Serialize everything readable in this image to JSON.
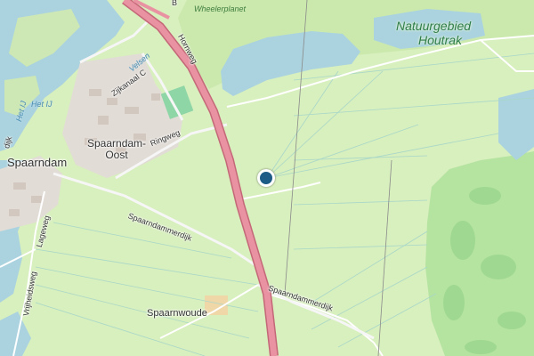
{
  "map": {
    "labels": {
      "natuurgebied": "Natuurgebied",
      "houtrak": "Houtrak",
      "wheelerplanet": "Wheelerplanet",
      "spaarndam": "Spaarndam",
      "spaarndam_oost_1": "Spaarndam-",
      "spaarndam_oost_2": "Oost",
      "spaarnwoude": "Spaarnwoude",
      "het_ij_1": "Het IJ",
      "het_ij_2": "Het IJ",
      "velsen": "Velsen",
      "zijkanaal": "Zijkanaal C",
      "hornweg": "Hornweg",
      "ringweg": "Ringweg",
      "spaarndammerdijk_1": "Spaarndammerdijk",
      "spaarndammerdijk_2": "Spaarndammerdijk",
      "lageweg": "Lageweg",
      "vrijheidsweg": "Vrijheidsweg",
      "dijk": "dijk",
      "b": "B"
    },
    "colors": {
      "farmland": "#d8efbe",
      "water": "#aad3df",
      "park": "#c8e9a8",
      "golf": "#b5e3a0",
      "residential": "#e2dcd6",
      "highway": "#e892a2",
      "marker": "#1c5c86"
    },
    "marker_icon": "location-dot"
  }
}
